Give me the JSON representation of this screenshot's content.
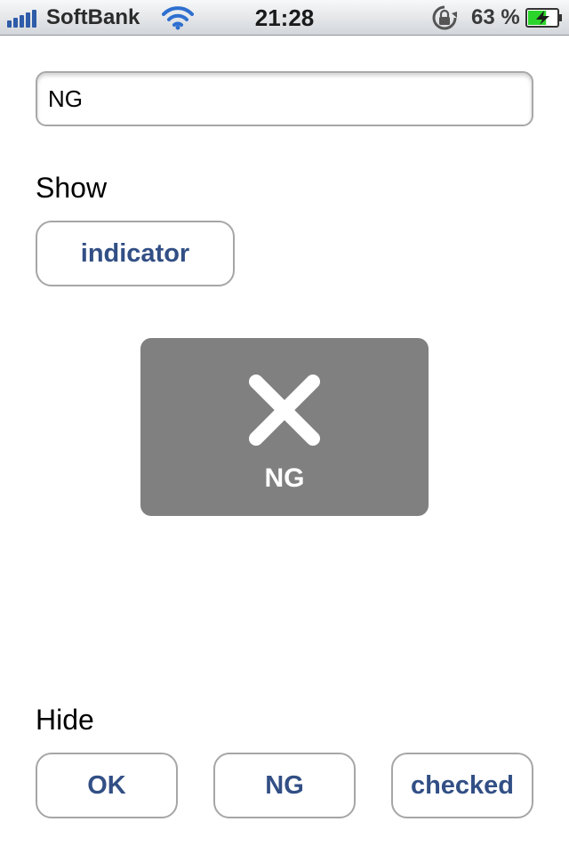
{
  "status_bar": {
    "carrier": "SoftBank",
    "time": "21:28",
    "battery_percent": "63 %",
    "battery_level": 0.63,
    "icons": [
      "signal-icon",
      "wifi-icon",
      "rotation-lock-icon",
      "battery-charging-icon"
    ]
  },
  "text_field": {
    "value": "NG"
  },
  "show_section": {
    "label": "Show",
    "indicator_button": "indicator"
  },
  "hud": {
    "icon": "cross-icon",
    "label": "NG"
  },
  "hide_section": {
    "label": "Hide",
    "buttons": [
      "OK",
      "NG",
      "checked"
    ]
  },
  "colors": {
    "button_text": "#324f85",
    "hud_background": "#808080",
    "battery_fill": "#2bd52b"
  }
}
